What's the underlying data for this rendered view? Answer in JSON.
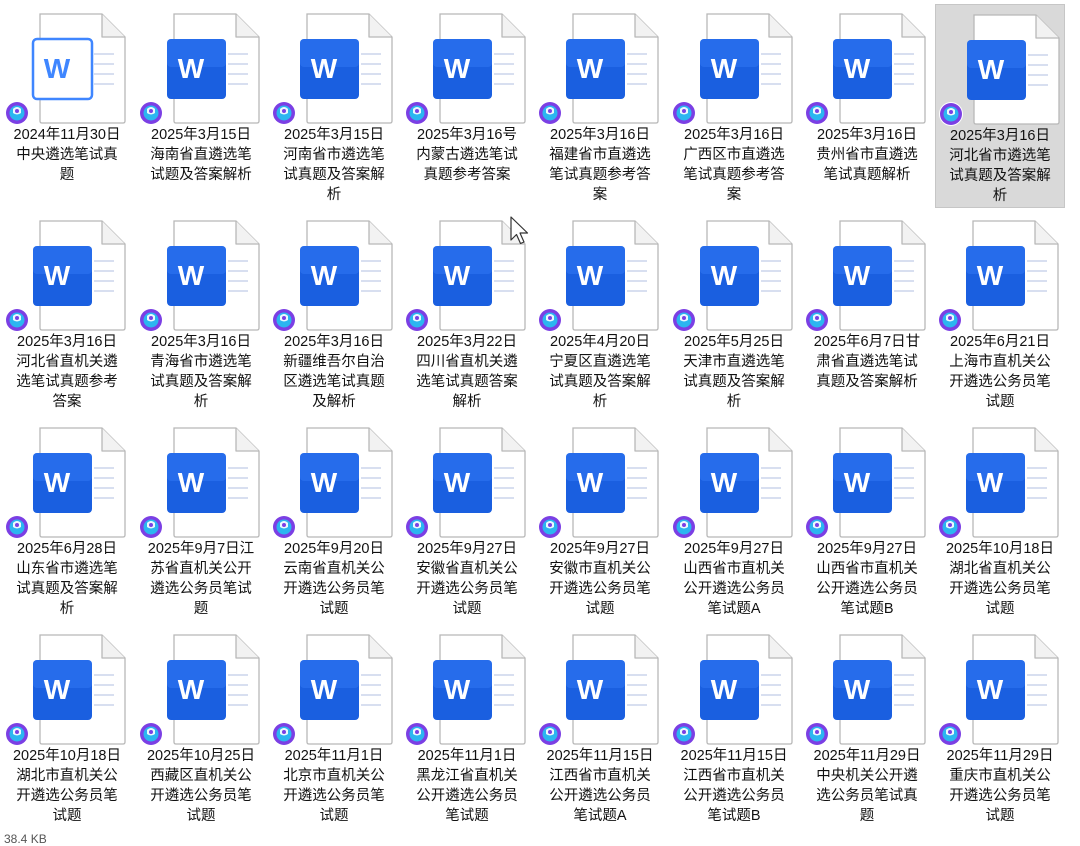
{
  "app_letter": "W",
  "status_text": "38.4 KB",
  "colors": {
    "word_blue": "#1a5fe0",
    "word_blue_light": "#3f86ff",
    "badge_outer": "#7b3fe4",
    "badge_inner": "#2bb6f0",
    "selection": "#d9d9d9"
  },
  "files": [
    {
      "name": "2024年11月30日中央遴选笔试真题",
      "lines": [
        "2024年11月30日",
        "中央遴选笔试真",
        "题"
      ],
      "selected": false,
      "icon_style": "outline"
    },
    {
      "name": "2025年3月15日海南省直遴选笔试题及答案解析",
      "lines": [
        "2025年3月15日",
        "海南省直遴选笔",
        "试题及答案解析"
      ],
      "selected": false
    },
    {
      "name": "2025年3月15日河南省市遴选笔试真题及答案解析",
      "lines": [
        "2025年3月15日",
        "河南省市遴选笔",
        "试真题及答案解",
        "析"
      ],
      "selected": false
    },
    {
      "name": "2025年3月16号内蒙古遴选笔试真题参考答案",
      "lines": [
        "2025年3月16号",
        "内蒙古遴选笔试",
        "真题参考答案"
      ],
      "selected": false
    },
    {
      "name": "2025年3月16日福建省市直遴选笔试真题参考答案",
      "lines": [
        "2025年3月16日",
        "福建省市直遴选",
        "笔试真题参考答",
        "案"
      ],
      "selected": false
    },
    {
      "name": "2025年3月16日广西区市直遴选笔试真题参考答案",
      "lines": [
        "2025年3月16日",
        "广西区市直遴选",
        "笔试真题参考答",
        "案"
      ],
      "selected": false
    },
    {
      "name": "2025年3月16日贵州省市直遴选笔试真题解析",
      "lines": [
        "2025年3月16日",
        "贵州省市直遴选",
        "笔试真题解析"
      ],
      "selected": false
    },
    {
      "name": "2025年3月16日河北省市遴选笔试真题及答案解析",
      "lines": [
        "2025年3月16日",
        "河北省市遴选笔",
        "试真题及答案解",
        "析"
      ],
      "selected": true
    },
    {
      "name": "2025年3月16日河北省直机关遴选笔试真题参考答案",
      "lines": [
        "2025年3月16日",
        "河北省直机关遴",
        "选笔试真题参考",
        "答案"
      ],
      "selected": false
    },
    {
      "name": "2025年3月16日青海省市遴选笔试真题及答案解析",
      "lines": [
        "2025年3月16日",
        "青海省市遴选笔",
        "试真题及答案解",
        "析"
      ],
      "selected": false
    },
    {
      "name": "2025年3月16日新疆维吾尔自治区遴选笔试真题及解析",
      "lines": [
        "2025年3月16日",
        "新疆维吾尔自治",
        "区遴选笔试真题",
        "及解析"
      ],
      "selected": false
    },
    {
      "name": "2025年3月22日四川省直机关遴选笔试真题答案解析",
      "lines": [
        "2025年3月22日",
        "四川省直机关遴",
        "选笔试真题答案",
        "解析"
      ],
      "selected": false
    },
    {
      "name": "2025年4月20日宁夏区直遴选笔试真题及答案解析",
      "lines": [
        "2025年4月20日",
        "宁夏区直遴选笔",
        "试真题及答案解",
        "析"
      ],
      "selected": false
    },
    {
      "name": "2025年5月25日天津市直遴选笔试真题及答案解析",
      "lines": [
        "2025年5月25日",
        "天津市直遴选笔",
        "试真题及答案解",
        "析"
      ],
      "selected": false
    },
    {
      "name": "2025年6月7日甘肃省直遴选笔试真题及答案解析",
      "lines": [
        "2025年6月7日甘",
        "肃省直遴选笔试",
        "真题及答案解析"
      ],
      "selected": false
    },
    {
      "name": "2025年6月21日上海市直机关公开遴选公务员笔试题",
      "lines": [
        "2025年6月21日",
        "上海市直机关公",
        "开遴选公务员笔",
        "试题"
      ],
      "selected": false
    },
    {
      "name": "2025年6月28日山东省市遴选笔试真题及答案解析",
      "lines": [
        "2025年6月28日",
        "山东省市遴选笔",
        "试真题及答案解",
        "析"
      ],
      "selected": false
    },
    {
      "name": "2025年9月7日江苏省直机关公开遴选公务员笔试题",
      "lines": [
        "2025年9月7日江",
        "苏省直机关公开",
        "遴选公务员笔试",
        "题"
      ],
      "selected": false
    },
    {
      "name": "2025年9月20日云南省直机关公开遴选公务员笔试题",
      "lines": [
        "2025年9月20日",
        "云南省直机关公",
        "开遴选公务员笔",
        "试题"
      ],
      "selected": false
    },
    {
      "name": "2025年9月27日安徽省直机关公开遴选公务员笔试题",
      "lines": [
        "2025年9月27日",
        "安徽省直机关公",
        "开遴选公务员笔",
        "试题"
      ],
      "selected": false
    },
    {
      "name": "2025年9月27日安徽市直机关公开遴选公务员笔试题",
      "lines": [
        "2025年9月27日",
        "安徽市直机关公",
        "开遴选公务员笔",
        "试题"
      ],
      "selected": false
    },
    {
      "name": "2025年9月27日山西省市直机关公开遴选公务员笔试题A",
      "lines": [
        "2025年9月27日",
        "山西省市直机关",
        "公开遴选公务员",
        "笔试题A"
      ],
      "selected": false
    },
    {
      "name": "2025年9月27日山西省市直机关公开遴选公务员笔试题B",
      "lines": [
        "2025年9月27日",
        "山西省市直机关",
        "公开遴选公务员",
        "笔试题B"
      ],
      "selected": false
    },
    {
      "name": "2025年10月18日湖北省直机关公开遴选公务员笔试题",
      "lines": [
        "2025年10月18日",
        "湖北省直机关公",
        "开遴选公务员笔",
        "试题"
      ],
      "selected": false
    },
    {
      "name": "2025年10月18日湖北市直机关公开遴选公务员笔试题",
      "lines": [
        "2025年10月18日",
        "湖北市直机关公",
        "开遴选公务员笔",
        "试题"
      ],
      "selected": false
    },
    {
      "name": "2025年10月25日西藏区直机关公开遴选公务员笔试题",
      "lines": [
        "2025年10月25日",
        "西藏区直机关公",
        "开遴选公务员笔",
        "试题"
      ],
      "selected": false
    },
    {
      "name": "2025年11月1日北京市直机关公开遴选公务员笔试题",
      "lines": [
        "2025年11月1日",
        "北京市直机关公",
        "开遴选公务员笔",
        "试题"
      ],
      "selected": false
    },
    {
      "name": "2025年11月1日黑龙江省直机关公开遴选公务员笔试题",
      "lines": [
        "2025年11月1日",
        "黑龙江省直机关",
        "公开遴选公务员",
        "笔试题"
      ],
      "selected": false
    },
    {
      "name": "2025年11月15日江西省市直机关公开遴选公务员笔试题A",
      "lines": [
        "2025年11月15日",
        "江西省市直机关",
        "公开遴选公务员",
        "笔试题A"
      ],
      "selected": false
    },
    {
      "name": "2025年11月15日江西省市直机关公开遴选公务员笔试题B",
      "lines": [
        "2025年11月15日",
        "江西省市直机关",
        "公开遴选公务员",
        "笔试题B"
      ],
      "selected": false
    },
    {
      "name": "2025年11月29日中央机关公开遴选公务员笔试真题",
      "lines": [
        "2025年11月29日",
        "中央机关公开遴",
        "选公务员笔试真",
        "题"
      ],
      "selected": false
    },
    {
      "name": "2025年11月29日重庆市直机关公开遴选公务员笔试题",
      "lines": [
        "2025年11月29日",
        "重庆市直机关公",
        "开遴选公务员笔",
        "试题"
      ],
      "selected": false
    }
  ]
}
